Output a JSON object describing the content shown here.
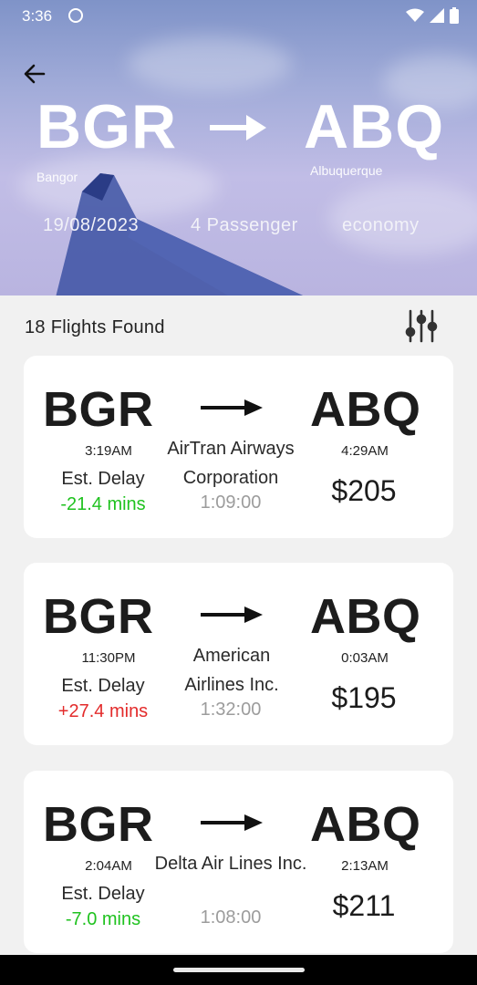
{
  "status_bar": {
    "time": "3:36",
    "icons": [
      "circle-icon",
      "wifi-icon",
      "signal-icon",
      "battery-icon"
    ]
  },
  "header": {
    "origin_code": "BGR",
    "origin_city": "Bangor",
    "destination_code": "ABQ",
    "destination_city": "Albuquerque",
    "date": "19/08/2023",
    "passengers": "4 Passenger",
    "cabin": "economy"
  },
  "results": {
    "count_label": "18 Flights Found"
  },
  "colors": {
    "delay_negative": "#1fc21f",
    "delay_positive": "#e32b2b",
    "duration_gray": "#9c9c9c"
  },
  "flights": [
    {
      "origin": "BGR",
      "destination": "ABQ",
      "departure": "3:19AM",
      "arrival": "4:29AM",
      "airline": "AirTran Airways Corporation",
      "duration": "1:09:00",
      "delay_label": "Est. Delay",
      "delay_value": "-21.4 mins",
      "price": "$205"
    },
    {
      "origin": "BGR",
      "destination": "ABQ",
      "departure": "11:30PM",
      "arrival": "0:03AM",
      "airline": "American Airlines Inc.",
      "duration": "1:32:00",
      "delay_label": "Est. Delay",
      "delay_value": "+27.4 mins",
      "price": "$195"
    },
    {
      "origin": "BGR",
      "destination": "ABQ",
      "departure": "2:04AM",
      "arrival": "2:13AM",
      "airline": "Delta Air Lines Inc.",
      "duration": "1:08:00",
      "delay_label": "Est. Delay",
      "delay_value": "-7.0 mins",
      "price": "$211"
    }
  ]
}
